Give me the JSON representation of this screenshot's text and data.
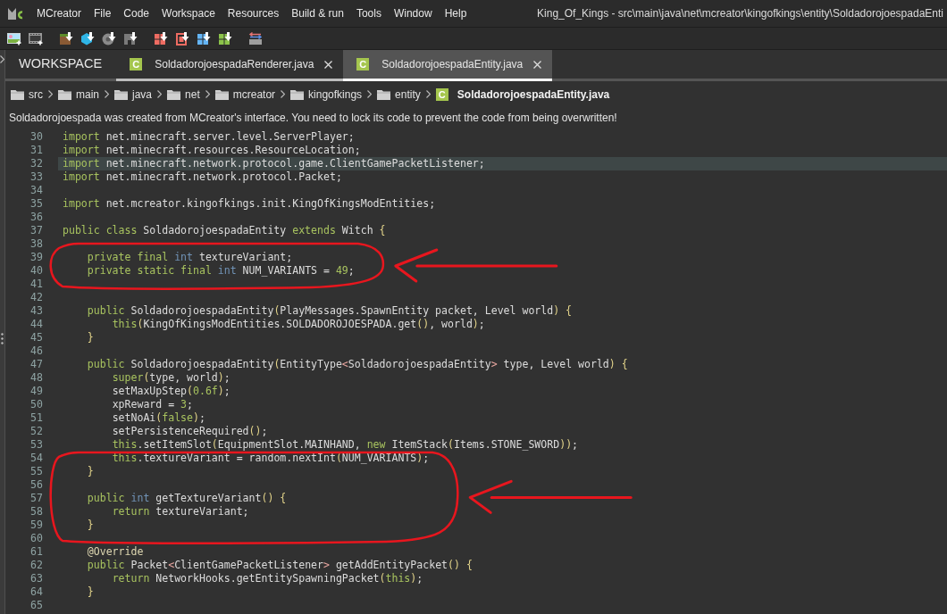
{
  "menu_bar": {
    "items": [
      "MCreator",
      "File",
      "Code",
      "Workspace",
      "Resources",
      "Build & run",
      "Tools",
      "Window",
      "Help"
    ],
    "title": "King_Of_Kings - src\\main\\java\\net\\mcreator\\kingofkings\\entity\\SoldadorojoespadaEnti"
  },
  "tabs": [
    {
      "label": "WORKSPACE",
      "kind": "workspace",
      "selected": false
    },
    {
      "label": "SoldadorojoespadaRenderer.java",
      "kind": "file",
      "badge": "C",
      "selected": false
    },
    {
      "label": "SoldadorojoespadaEntity.java",
      "kind": "file",
      "badge": "C",
      "selected": true
    }
  ],
  "breadcrumb": [
    {
      "label": "src",
      "kind": "folder"
    },
    {
      "label": "main",
      "kind": "folder"
    },
    {
      "label": "java",
      "kind": "folder"
    },
    {
      "label": "net",
      "kind": "folder"
    },
    {
      "label": "mcreator",
      "kind": "folder"
    },
    {
      "label": "kingofkings",
      "kind": "folder"
    },
    {
      "label": "entity",
      "kind": "folder"
    },
    {
      "label": "SoldadorojoespadaEntity.java",
      "kind": "file",
      "badge": "C"
    }
  ],
  "notice": "Soldadorojoespada was created from MCreator's interface. You need to lock its code to prevent the code from being overwritten!",
  "code": {
    "segments": [
      {
        "circled": false,
        "lines": [
          {
            "number": "30",
            "tokens": [
              {
                "kind": "keyword",
                "text": "import"
              },
              {
                "kind": "plain",
                "text": " net.minecraft.server.level.ServerPlayer;"
              }
            ],
            "current": false
          },
          {
            "number": "31",
            "tokens": [
              {
                "kind": "keyword",
                "text": "import"
              },
              {
                "kind": "plain",
                "text": " net.minecraft.resources.ResourceLocation;"
              }
            ],
            "current": false
          },
          {
            "number": "32",
            "tokens": [
              {
                "kind": "keyword",
                "text": "import"
              },
              {
                "kind": "plain",
                "text": " net.minecraft.network.protocol.game.ClientGamePacketListener;"
              }
            ],
            "current": true
          },
          {
            "number": "33",
            "tokens": [
              {
                "kind": "keyword",
                "text": "import"
              },
              {
                "kind": "plain",
                "text": " net.minecraft.network.protocol.Packet;"
              }
            ],
            "current": false
          },
          {
            "number": "34",
            "current": false
          },
          {
            "number": "35",
            "tokens": [
              {
                "kind": "keyword",
                "text": "import"
              },
              {
                "kind": "plain",
                "text": " net.mcreator.kingofkings.init.KingOfKingsModEntities;"
              }
            ],
            "current": false
          },
          {
            "number": "36",
            "current": false
          },
          {
            "number": "37",
            "tokens": [
              {
                "kind": "keyword",
                "text": "public class"
              },
              {
                "kind": "plain",
                "text": " SoldadorojoespadaEntity "
              },
              {
                "kind": "keyword",
                "text": "extends"
              },
              {
                "kind": "plain",
                "text": " Witch "
              },
              {
                "kind": "bracket",
                "text": "{"
              }
            ],
            "current": false
          },
          {
            "number": "38",
            "current": false
          }
        ]
      },
      {
        "circled": true,
        "lines": [
          {
            "number": "39",
            "tokens": [
              {
                "kind": "keyword",
                "text": "    private final "
              },
              {
                "kind": "primitive",
                "text": "int"
              },
              {
                "kind": "plain",
                "text": " textureVariant;"
              }
            ],
            "current": false
          },
          {
            "number": "40",
            "tokens": [
              {
                "kind": "keyword",
                "text": "    private static final "
              },
              {
                "kind": "primitive",
                "text": "int"
              },
              {
                "kind": "plain",
                "text": " NUM_VARIANTS = "
              },
              {
                "kind": "literal",
                "text": "49"
              },
              {
                "kind": "plain",
                "text": ";"
              }
            ],
            "current": false
          }
        ]
      },
      {
        "circled": false,
        "lines": [
          {
            "number": "41",
            "current": false
          },
          {
            "number": "42",
            "current": false
          },
          {
            "number": "43",
            "tokens": [
              {
                "kind": "keyword",
                "text": "    public"
              },
              {
                "kind": "plain",
                "text": " SoldadorojoespadaEntity"
              },
              {
                "kind": "bracket",
                "text": "("
              },
              {
                "kind": "plain",
                "text": "PlayMessages.SpawnEntity packet, Level world"
              },
              {
                "kind": "bracket",
                "text": ") {"
              }
            ],
            "current": false
          },
          {
            "number": "44",
            "tokens": [
              {
                "kind": "keyword",
                "text": "        this"
              },
              {
                "kind": "bracket",
                "text": "("
              },
              {
                "kind": "plain",
                "text": "KingOfKingsModEntities.SOLDADOROJOESPADA.get"
              },
              {
                "kind": "bracket",
                "text": "()"
              },
              {
                "kind": "plain",
                "text": ", world"
              },
              {
                "kind": "bracket",
                "text": ")"
              },
              {
                "kind": "plain",
                "text": ";"
              }
            ],
            "current": false
          },
          {
            "number": "45",
            "tokens": [
              {
                "kind": "bracket",
                "text": "    }"
              }
            ],
            "current": false
          },
          {
            "number": "46",
            "current": false
          },
          {
            "number": "47",
            "tokens": [
              {
                "kind": "keyword",
                "text": "    public"
              },
              {
                "kind": "plain",
                "text": " SoldadorojoespadaEntity"
              },
              {
                "kind": "bracket",
                "text": "("
              },
              {
                "kind": "plain",
                "text": "EntityType"
              },
              {
                "kind": "angle",
                "text": "<"
              },
              {
                "kind": "plain",
                "text": "SoldadorojoespadaEntity"
              },
              {
                "kind": "angle",
                "text": ">"
              },
              {
                "kind": "plain",
                "text": " type, Level world"
              },
              {
                "kind": "bracket",
                "text": ") {"
              }
            ],
            "current": false
          },
          {
            "number": "48",
            "tokens": [
              {
                "kind": "keyword",
                "text": "        super"
              },
              {
                "kind": "bracket",
                "text": "("
              },
              {
                "kind": "plain",
                "text": "type, world"
              },
              {
                "kind": "bracket",
                "text": ")"
              },
              {
                "kind": "plain",
                "text": ";"
              }
            ],
            "current": false
          },
          {
            "number": "49",
            "tokens": [
              {
                "kind": "plain",
                "text": "        setMaxUpStep"
              },
              {
                "kind": "bracket",
                "text": "("
              },
              {
                "kind": "literal",
                "text": "0.6f"
              },
              {
                "kind": "bracket",
                "text": ")"
              },
              {
                "kind": "plain",
                "text": ";"
              }
            ],
            "current": false
          },
          {
            "number": "50",
            "tokens": [
              {
                "kind": "plain",
                "text": "        xpReward = "
              },
              {
                "kind": "literal",
                "text": "3"
              },
              {
                "kind": "plain",
                "text": ";"
              }
            ],
            "current": false
          },
          {
            "number": "51",
            "tokens": [
              {
                "kind": "plain",
                "text": "        setNoAi"
              },
              {
                "kind": "bracket",
                "text": "("
              },
              {
                "kind": "literal",
                "text": "false"
              },
              {
                "kind": "bracket",
                "text": ")"
              },
              {
                "kind": "plain",
                "text": ";"
              }
            ],
            "current": false
          },
          {
            "number": "52",
            "tokens": [
              {
                "kind": "plain",
                "text": "        setPersistenceRequired"
              },
              {
                "kind": "bracket",
                "text": "()"
              },
              {
                "kind": "plain",
                "text": ";"
              }
            ],
            "current": false
          },
          {
            "number": "53",
            "tokens": [
              {
                "kind": "keyword",
                "text": "        this"
              },
              {
                "kind": "plain",
                "text": ".setItemSlot"
              },
              {
                "kind": "bracket",
                "text": "("
              },
              {
                "kind": "plain",
                "text": "EquipmentSlot.MAINHAND, "
              },
              {
                "kind": "keyword",
                "text": "new"
              },
              {
                "kind": "plain",
                "text": " ItemStack"
              },
              {
                "kind": "bracket",
                "text": "("
              },
              {
                "kind": "plain",
                "text": "Items.STONE_SWORD"
              },
              {
                "kind": "bracket",
                "text": "))"
              },
              {
                "kind": "plain",
                "text": ";"
              }
            ],
            "current": false
          }
        ]
      },
      {
        "circled": true,
        "lines": [
          {
            "number": "54",
            "tokens": [
              {
                "kind": "keyword",
                "text": "        this"
              },
              {
                "kind": "plain",
                "text": ".textureVariant = random.nextInt"
              },
              {
                "kind": "bracket",
                "text": "("
              },
              {
                "kind": "plain",
                "text": "NUM_VARIANTS"
              },
              {
                "kind": "bracket",
                "text": ")"
              },
              {
                "kind": "plain",
                "text": ";"
              }
            ],
            "current": false
          },
          {
            "number": "55",
            "tokens": [
              {
                "kind": "bracket",
                "text": "    }"
              }
            ],
            "current": false
          },
          {
            "number": "56",
            "current": false
          },
          {
            "number": "57",
            "tokens": [
              {
                "kind": "keyword",
                "text": "    public "
              },
              {
                "kind": "primitive",
                "text": "int"
              },
              {
                "kind": "plain",
                "text": " getTextureVariant"
              },
              {
                "kind": "bracket",
                "text": "() {"
              }
            ],
            "current": false
          },
          {
            "number": "58",
            "tokens": [
              {
                "kind": "keyword",
                "text": "        return"
              },
              {
                "kind": "plain",
                "text": " textureVariant;"
              }
            ],
            "current": false
          },
          {
            "number": "59",
            "tokens": [
              {
                "kind": "bracket",
                "text": "    }"
              }
            ],
            "current": false
          }
        ]
      },
      {
        "circled": false,
        "lines": [
          {
            "number": "60",
            "current": false
          },
          {
            "number": "61",
            "tokens": [
              {
                "kind": "annotation",
                "text": "    @Override"
              }
            ],
            "current": false
          },
          {
            "number": "62",
            "tokens": [
              {
                "kind": "keyword",
                "text": "    public"
              },
              {
                "kind": "plain",
                "text": " Packet"
              },
              {
                "kind": "angle",
                "text": "<"
              },
              {
                "kind": "plain",
                "text": "ClientGamePacketListener"
              },
              {
                "kind": "angle",
                "text": ">"
              },
              {
                "kind": "plain",
                "text": " getAddEntityPacket"
              },
              {
                "kind": "bracket",
                "text": "() {"
              }
            ],
            "current": false
          },
          {
            "number": "63",
            "tokens": [
              {
                "kind": "keyword",
                "text": "        return"
              },
              {
                "kind": "plain",
                "text": " NetworkHooks.getEntitySpawningPacket"
              },
              {
                "kind": "bracket",
                "text": "("
              },
              {
                "kind": "keyword",
                "text": "this"
              },
              {
                "kind": "bracket",
                "text": ")"
              },
              {
                "kind": "plain",
                "text": ";"
              }
            ],
            "current": false
          },
          {
            "number": "64",
            "tokens": [
              {
                "kind": "bracket",
                "text": "    }"
              }
            ],
            "current": false
          },
          {
            "number": "65",
            "current": false
          }
        ]
      }
    ]
  }
}
